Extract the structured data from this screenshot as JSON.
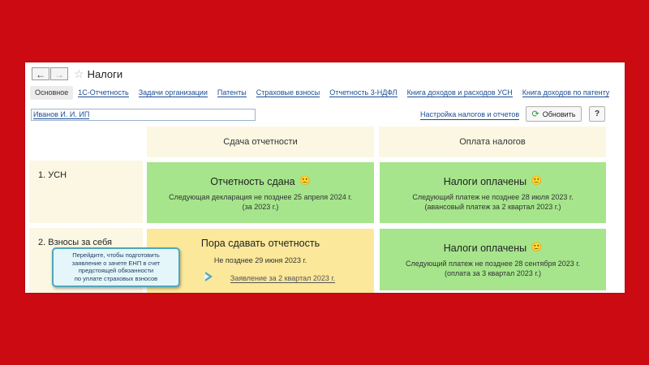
{
  "window": {
    "title": "Налоги"
  },
  "tabs": [
    {
      "label": "Основное"
    },
    {
      "label": "1С-Отчетность"
    },
    {
      "label": "Задачи организации"
    },
    {
      "label": "Патенты"
    },
    {
      "label": "Страховые взносы"
    },
    {
      "label": "Отчетность 3-НДФЛ"
    },
    {
      "label": "Книга доходов и расходов УСН"
    },
    {
      "label": "Книга доходов по патенту"
    }
  ],
  "organization": {
    "value": "Иванов И. И. ИП"
  },
  "toolbar": {
    "settings_link": "Настройка налогов и отчетов",
    "refresh_label": "Обновить",
    "help_label": "?"
  },
  "table": {
    "headers": {
      "reporting": "Сдача отчетности",
      "payment": "Оплата налогов"
    },
    "rows": [
      {
        "label": "1. УСН",
        "reporting": {
          "status": "Отчетность сдана",
          "line1": "Следующая декларация не позднее 25 апреля 2024 г.",
          "line2": "(за 2023 г.)"
        },
        "payment": {
          "status": "Налоги оплачены",
          "line1": "Следующий платеж не позднее 28 июля 2023 г.",
          "line2": "(авансовый платеж за 2 квартал 2023 г.)"
        }
      },
      {
        "label": "2. Взносы за себя",
        "reporting": {
          "status": "Пора сдавать отчетность",
          "line1": "Не позднее 29 июня 2023 г.",
          "link": "Заявление за 2 квартал 2023 г."
        },
        "payment": {
          "status": "Налоги оплачены",
          "line1": "Следующий платеж не позднее 28 сентября 2023 г.",
          "line2": "(оплата за 3 квартал 2023 г.)"
        }
      }
    ]
  },
  "hint": {
    "line1": "Перейдите, чтобы подготовить",
    "line2": "заявление о зачете ЕНП в счет",
    "line3": "предстоящей обязанности",
    "line4": "по уплате страховых взносов"
  },
  "icons": {
    "smiley": "smiley-icon",
    "refresh": "refresh-icon",
    "star": "star-icon"
  },
  "colors": {
    "background": "#cc0a12",
    "ok_cell": "#a6e58c",
    "due_cell": "#fbe89a",
    "header_cell": "#fbf7e2",
    "link": "#1a4c96"
  }
}
